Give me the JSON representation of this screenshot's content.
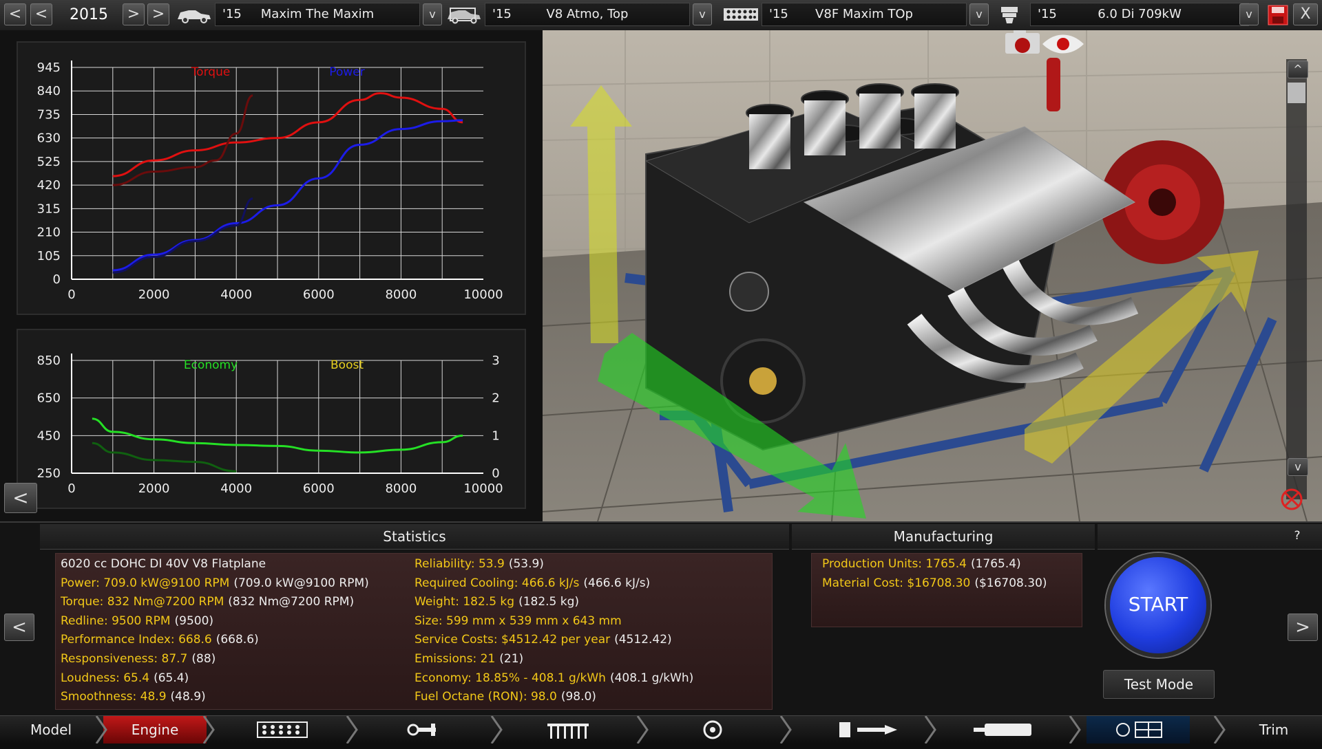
{
  "topbar": {
    "year": "2015",
    "model": {
      "year": "'15",
      "name": "Maxim The Maxim"
    },
    "family": {
      "year": "'15",
      "name": "V8 Atmo, Top"
    },
    "variant": {
      "year": "'15",
      "name": "V8F Maxim TOp"
    },
    "engine": {
      "year": "'15",
      "name": "6.0 Di 709kW"
    },
    "nav": {
      "prev2": "<",
      "prev1": "<",
      "next1": ">",
      "next2": ">",
      "dropdown": "v",
      "close": "X"
    }
  },
  "chart_data": [
    {
      "type": "line",
      "legend": [
        "Torque",
        "Power"
      ],
      "xlim": [
        0,
        10000
      ],
      "ylim": [
        0,
        945
      ],
      "x_ticks": [
        "0",
        "2000",
        "4000",
        "6000",
        "8000",
        "10000"
      ],
      "y_ticks": [
        "0",
        "105",
        "210",
        "315",
        "420",
        "525",
        "630",
        "735",
        "840",
        "945"
      ],
      "series": [
        {
          "name": "Torque",
          "color": "#e01010",
          "x": [
            1000,
            2000,
            3000,
            4000,
            5000,
            6000,
            7000,
            7500,
            8000,
            9000,
            9500
          ],
          "y": [
            460,
            530,
            575,
            610,
            630,
            700,
            800,
            830,
            810,
            760,
            700
          ]
        },
        {
          "name": "Power",
          "color": "#1c1ce8",
          "x": [
            1000,
            2000,
            3000,
            4000,
            5000,
            6000,
            7000,
            8000,
            9000,
            9500
          ],
          "y": [
            40,
            110,
            175,
            250,
            330,
            450,
            600,
            670,
            705,
            709
          ]
        },
        {
          "color": "#6a0c0c",
          "x": [
            1000,
            2000,
            3000,
            3500,
            4000,
            4400
          ],
          "y": [
            420,
            480,
            500,
            530,
            650,
            820
          ]
        },
        {
          "color": "#101060",
          "x": [
            1000,
            2000,
            3000,
            4000,
            4400
          ],
          "y": [
            30,
            100,
            170,
            240,
            360
          ]
        }
      ]
    },
    {
      "type": "line",
      "legend": [
        "Economy",
        "Boost"
      ],
      "xlim": [
        0,
        10000
      ],
      "ylim": [
        250,
        850
      ],
      "y2lim": [
        0,
        3
      ],
      "x_ticks": [
        "0",
        "2000",
        "4000",
        "6000",
        "8000",
        "10000"
      ],
      "y_ticks": [
        "250",
        "450",
        "650",
        "850"
      ],
      "y2_ticks": [
        "0",
        "1",
        "2",
        "3"
      ],
      "series": [
        {
          "name": "Economy",
          "color": "#25e025",
          "x": [
            500,
            1000,
            2000,
            3000,
            4000,
            5000,
            6000,
            7000,
            8000,
            9000,
            9500
          ],
          "y": [
            540,
            470,
            430,
            410,
            400,
            395,
            370,
            360,
            375,
            415,
            450
          ]
        },
        {
          "color": "#106010",
          "x": [
            500,
            1000,
            2000,
            3000,
            4000
          ],
          "y": [
            410,
            360,
            320,
            310,
            260
          ]
        }
      ]
    }
  ],
  "left_arrow": "<",
  "statistics": {
    "header": "Statistics",
    "left": [
      {
        "label": "6020 cc DOHC DI 40V V8 Flatplane",
        "paren": ""
      },
      {
        "label": "Power: 709.0 kW@9100 RPM",
        "paren": "(709.0 kW@9100 RPM)"
      },
      {
        "label": "Torque: 832 Nm@7200 RPM",
        "paren": "(832 Nm@7200 RPM)"
      },
      {
        "label": "Redline: 9500 RPM",
        "paren": "(9500)"
      },
      {
        "label": "Performance Index: 668.6",
        "paren": "(668.6)"
      },
      {
        "label": "Responsiveness: 87.7",
        "paren": "(88)"
      },
      {
        "label": "Loudness: 65.4",
        "paren": "(65.4)"
      },
      {
        "label": "Smoothness: 48.9",
        "paren": "(48.9)"
      }
    ],
    "right": [
      {
        "label": "Reliability: 53.9",
        "paren": "(53.9)"
      },
      {
        "label": "Required Cooling: 466.6 kJ/s",
        "paren": "(466.6 kJ/s)"
      },
      {
        "label": "Weight: 182.5 kg",
        "paren": "(182.5 kg)"
      },
      {
        "label": "Size: 599 mm x 539 mm x 643 mm",
        "paren": ""
      },
      {
        "label": "Service Costs: $4512.42 per year",
        "paren": "(4512.42)"
      },
      {
        "label": "Emissions: 21",
        "paren": "(21)"
      },
      {
        "label": "Economy: 18.85% - 408.1 g/kWh",
        "paren": "(408.1 g/kWh)"
      },
      {
        "label": "Fuel Octane (RON): 98.0",
        "paren": "(98.0)"
      }
    ]
  },
  "manufacturing": {
    "header": "Manufacturing",
    "rows": [
      {
        "label": "Production Units: 1765.4",
        "paren": "(1765.4)"
      },
      {
        "label": "Material Cost: $16708.30",
        "paren": "($16708.30)"
      }
    ]
  },
  "help": "?",
  "start_label": "START",
  "test_mode_label": "Test Mode",
  "nav_left": "<",
  "nav_right": ">",
  "scroll_up": "^",
  "scroll_down": "v",
  "tabs": {
    "model": "Model",
    "engine": "Engine",
    "trim": "Trim"
  },
  "colors": {
    "accent_red": "#c81414",
    "stat_yellow": "#f2c818",
    "start_blue": "#1f3de0"
  }
}
